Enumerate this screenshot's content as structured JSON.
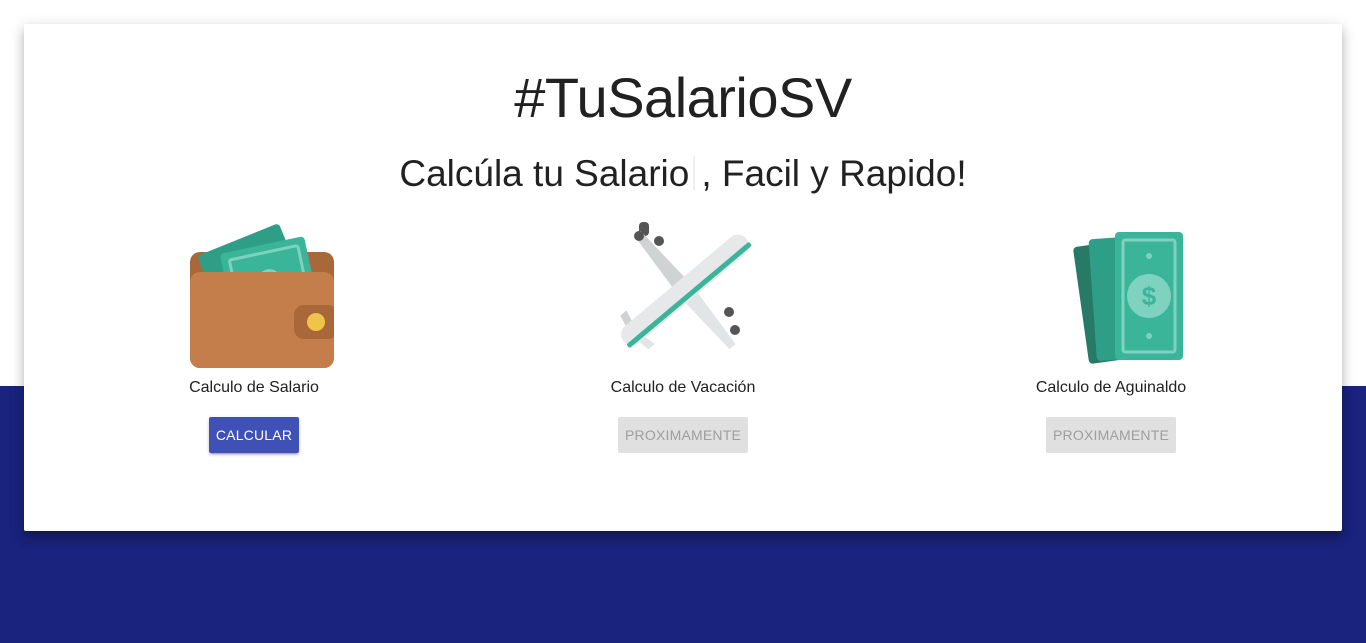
{
  "header": {
    "title": "#TuSalarioSV",
    "subtitle_part1": "Calcúla tu Salario",
    "subtitle_part2": ", Facil y Rapido!"
  },
  "features": [
    {
      "icon": "wallet-icon",
      "label": "Calculo de Salario",
      "button": "CALCULAR",
      "enabled": true
    },
    {
      "icon": "airplane-icon",
      "label": "Calculo de Vacación",
      "button": "PROXIMAMENTE",
      "enabled": false
    },
    {
      "icon": "money-icon",
      "label": "Calculo de Aguinaldo",
      "button": "PROXIMAMENTE",
      "enabled": false
    }
  ],
  "colors": {
    "primary": "#3f51b5",
    "background_bottom": "#1a237e",
    "disabled_bg": "#e0e0e0",
    "disabled_text": "#9e9e9e"
  }
}
